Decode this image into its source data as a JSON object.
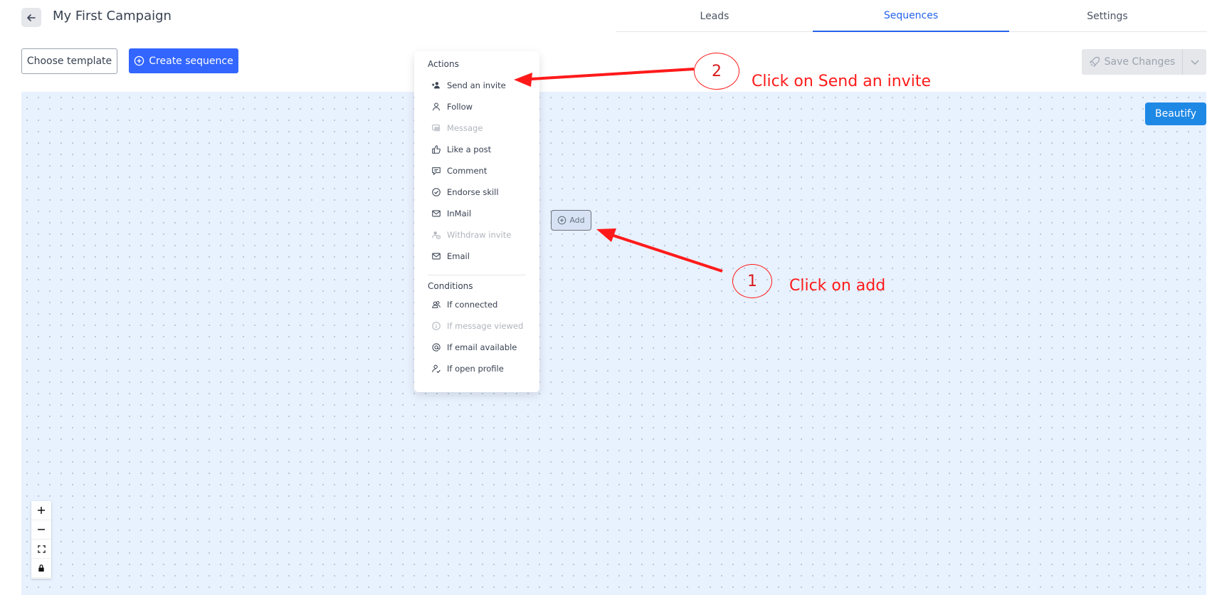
{
  "header": {
    "title": "My First Campaign"
  },
  "tabs": [
    {
      "label": "Leads"
    },
    {
      "label": "Sequences"
    },
    {
      "label": "Settings"
    }
  ],
  "toolbar": {
    "choose_template": "Choose template",
    "create_sequence": "Create sequence",
    "save_changes": "Save Changes",
    "beautify": "Beautify"
  },
  "canvas": {
    "add_label": "Add"
  },
  "menu": {
    "actions_heading": "Actions",
    "actions": [
      {
        "label": "Send an invite",
        "icon": "user-plus-icon"
      },
      {
        "label": "Follow",
        "icon": "user-icon"
      },
      {
        "label": "Message",
        "icon": "message-icon"
      },
      {
        "label": "Like a post",
        "icon": "thumbs-up-icon"
      },
      {
        "label": "Comment",
        "icon": "comment-icon"
      },
      {
        "label": "Endorse skill",
        "icon": "check-circle-icon"
      },
      {
        "label": "InMail",
        "icon": "mail-icon"
      },
      {
        "label": "Withdraw invite",
        "icon": "user-withdraw-icon"
      },
      {
        "label": "Email",
        "icon": "mail-icon"
      }
    ],
    "conditions_heading": "Conditions",
    "conditions": [
      {
        "label": "If connected",
        "icon": "users-icon"
      },
      {
        "label": "If message viewed",
        "icon": "info-icon"
      },
      {
        "label": "If email available",
        "icon": "at-icon"
      },
      {
        "label": "If open profile",
        "icon": "user-check-icon"
      }
    ]
  },
  "annotations": {
    "step1_number": "1",
    "step1_text": "Click on add",
    "step2_number": "2",
    "step2_text": "Click on Send an invite"
  },
  "colors": {
    "primary": "#3366ff",
    "active_tab": "#2563eb",
    "beautify": "#1e88e5",
    "canvas": "#e8f1fe",
    "annotation": "#ff1a1a"
  }
}
